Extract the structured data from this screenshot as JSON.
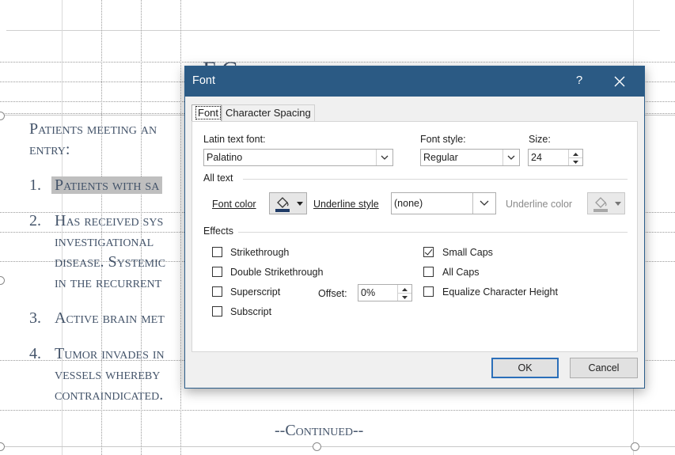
{
  "slide": {
    "heading_visible_fragment": "F        C",
    "intro_text": "Patients meeting an entry:",
    "items": [
      {
        "number": "1.",
        "lines": [
          "Patients with sa"
        ]
      },
      {
        "number": "2.",
        "lines": [
          "Has received sys",
          "investigational",
          "disease.  Systemic",
          "in the recurrent"
        ]
      },
      {
        "number": "3.",
        "lines": [
          "Active brain met"
        ]
      },
      {
        "number": "4.",
        "lines": [
          "Tumor invades in",
          "vessels whereby",
          "contraindicated."
        ]
      }
    ],
    "continued_label": "--Continued--"
  },
  "dialog": {
    "title": "Font",
    "help_label": "?",
    "tabs": {
      "font": "Font",
      "character_spacing": "Character Spacing"
    },
    "latin_font_label": "Latin text font:",
    "latin_font_value": "Palatino",
    "font_style_label": "Font style:",
    "font_style_value": "Regular",
    "size_label": "Size:",
    "size_value": "24",
    "all_text_label": "All text",
    "font_color_label": "Font color",
    "underline_style_label": "Underline style",
    "underline_style_value": "(none)",
    "underline_color_label": "Underline color",
    "effects_label": "Effects",
    "effects": {
      "strikethrough": {
        "label": "Strikethrough",
        "checked": false
      },
      "double_strikethrough": {
        "label": "Double Strikethrough",
        "checked": false
      },
      "superscript": {
        "label": "Superscript",
        "checked": false
      },
      "subscript": {
        "label": "Subscript",
        "checked": false
      },
      "small_caps": {
        "label": "Small Caps",
        "checked": true
      },
      "all_caps": {
        "label": "All Caps",
        "checked": false
      },
      "equalize": {
        "label": "Equalize Character Height",
        "checked": false
      }
    },
    "offset_label": "Offset:",
    "offset_value": "0%",
    "ok_label": "OK",
    "cancel_label": "Cancel"
  },
  "colors": {
    "titlebar": "#2b5a84",
    "slide_text": "#44546a",
    "selection_highlight": "#bfbfbf",
    "default_button_border": "#2b6fb9",
    "font_color_swatch": "#1f3b66"
  }
}
